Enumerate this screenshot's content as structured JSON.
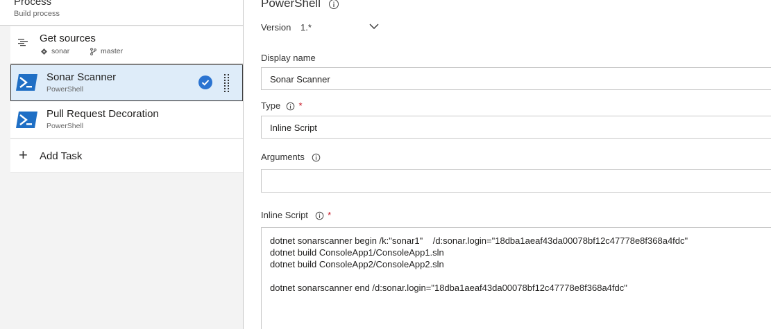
{
  "left": {
    "process_title": "Process",
    "process_subtitle": "Build process",
    "tasks": [
      {
        "title": "Get sources",
        "repo": "sonar",
        "branch": "master"
      },
      {
        "title": "Sonar Scanner",
        "subtitle": "PowerShell"
      },
      {
        "title": "Pull Request Decoration",
        "subtitle": "PowerShell"
      }
    ],
    "add_task": "Add Task"
  },
  "right": {
    "title": "PowerShell",
    "version_label": "Version",
    "version_value": "1.*",
    "display_name_label": "Display name",
    "display_name_value": "Sonar Scanner",
    "type_label": "Type",
    "type_value": "Inline Script",
    "arguments_label": "Arguments",
    "arguments_value": "",
    "inline_script_label": "Inline Script",
    "required_mark": "*",
    "inline_script_value": "dotnet sonarscanner begin /k:\"sonar1\"    /d:sonar.login=\"18dba1aeaf43da00078bf12c47778e8f368a4fdc\"\ndotnet build ConsoleApp1/ConsoleApp1.sln\ndotnet build ConsoleApp2/ConsoleApp2.sln\n\ndotnet sonarscanner end /d:sonar.login=\"18dba1aeaf43da00078bf12c47778e8f368a4fdc\""
  },
  "colors": {
    "selected_bg": "#deecf9",
    "accent": "#2b74d1",
    "powershell_blue": "#1f6fc5",
    "required_red": "#c50f1f"
  },
  "icons": [
    "list-icon",
    "repo-icon",
    "branch-icon",
    "powershell-icon",
    "check-circle-icon",
    "drag-handle-icon",
    "plus-icon",
    "info-icon",
    "chevron-down-icon"
  ]
}
